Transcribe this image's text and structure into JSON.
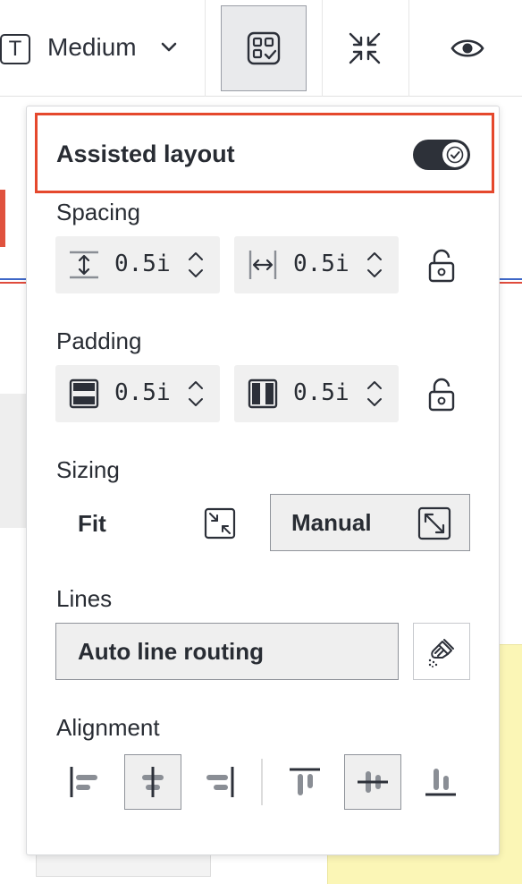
{
  "toolbar": {
    "font_size": "Medium",
    "font_icon_letter": "T"
  },
  "panel": {
    "assisted_layout_label": "Assisted layout",
    "assisted_layout_on": true,
    "spacing": {
      "label": "Spacing",
      "vertical_value": "0.5i",
      "horizontal_value": "0.5i"
    },
    "padding": {
      "label": "Padding",
      "vertical_value": "0.5i",
      "horizontal_value": "0.5i"
    },
    "sizing": {
      "label": "Sizing",
      "fit_label": "Fit",
      "manual_label": "Manual",
      "selected": "Manual"
    },
    "lines": {
      "label": "Lines",
      "auto_route_label": "Auto line routing"
    },
    "alignment": {
      "label": "Alignment",
      "horizontal_selected": "center",
      "vertical_selected": "middle"
    }
  },
  "colors": {
    "highlight": "#e5482d",
    "switch_on": "#2d3139",
    "sticky_note": "#fbf6b6"
  },
  "icons": [
    "text-style-icon",
    "chevron-down-icon",
    "assisted-layout-icon",
    "collapse-icon",
    "eye-icon",
    "checkmark-icon",
    "vertical-spacing-icon",
    "horizontal-spacing-icon",
    "padding-vertical-icon",
    "padding-horizontal-icon",
    "lock-icon",
    "fit-icon",
    "expand-icon",
    "paint-brush-icon",
    "align-left-icon",
    "align-center-icon",
    "align-right-icon",
    "align-top-icon",
    "align-middle-icon",
    "align-bottom-icon"
  ]
}
